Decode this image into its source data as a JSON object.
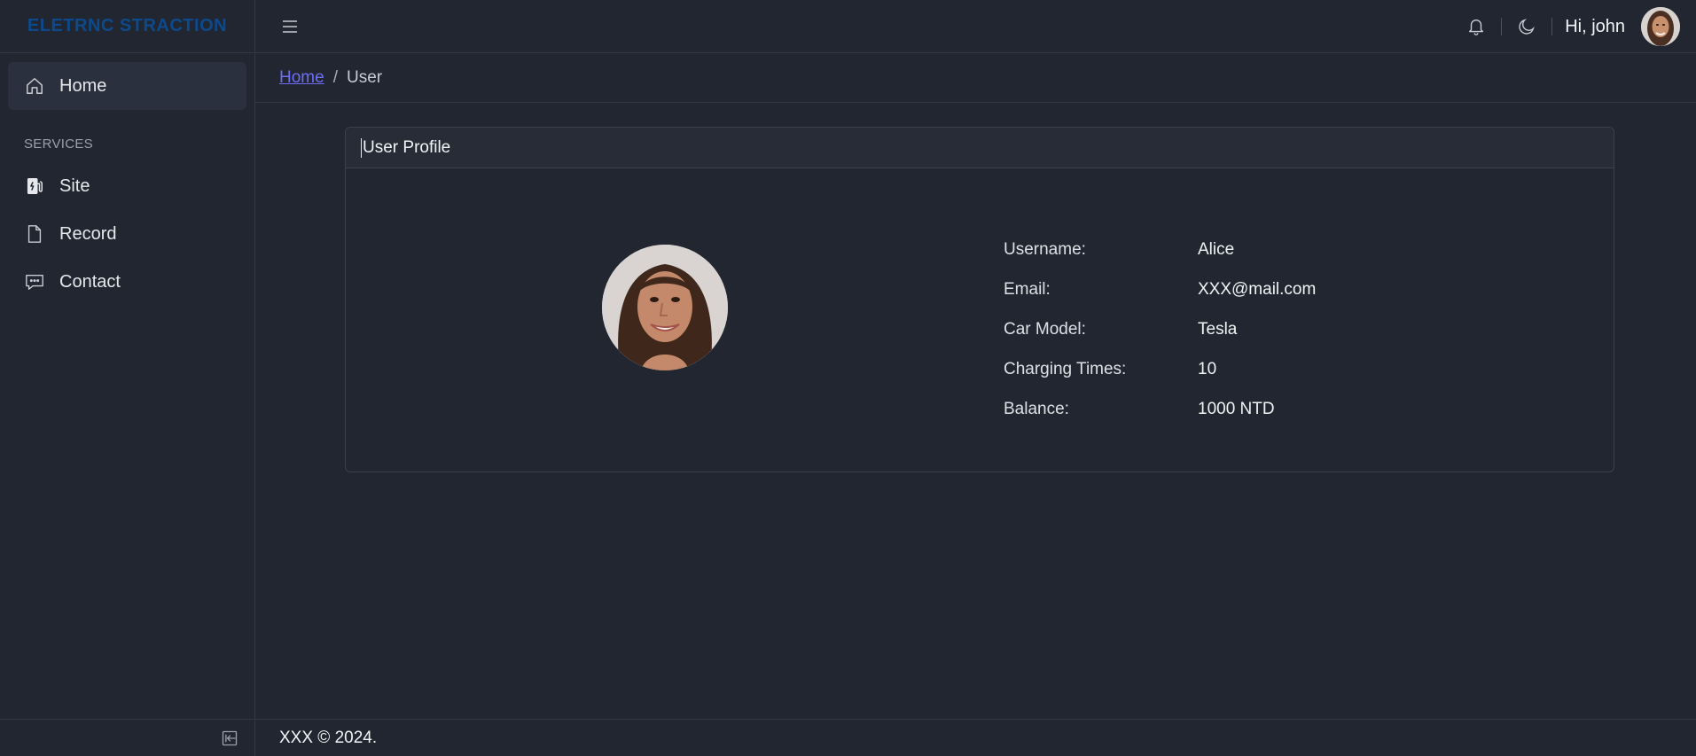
{
  "brand": {
    "name": "ELETRNC STRACTION",
    "color": "#0d4a8c"
  },
  "sidebar": {
    "items_top": [
      {
        "label": "Home",
        "icon": "home-icon",
        "active": true
      }
    ],
    "section_title": "SERVICES",
    "items": [
      {
        "label": "Site",
        "icon": "charging-station-icon"
      },
      {
        "label": "Record",
        "icon": "document-icon"
      },
      {
        "label": "Contact",
        "icon": "chat-icon"
      }
    ],
    "collapse_icon": "collapse-sidebar-icon"
  },
  "header": {
    "menu_icon": "hamburger-icon",
    "notification_icon": "bell-icon",
    "theme_icon": "moon-icon",
    "greeting": "Hi, john"
  },
  "breadcrumb": {
    "home": "Home",
    "separator": "/",
    "current": "User"
  },
  "card": {
    "title": "User Profile",
    "fields": [
      {
        "label": "Username:",
        "value": "Alice"
      },
      {
        "label": "Email:",
        "value": "XXX@mail.com"
      },
      {
        "label": "Car Model:",
        "value": "Tesla"
      },
      {
        "label": "Charging Times:",
        "value": "10"
      },
      {
        "label": "Balance:",
        "value": "1000 NTD"
      }
    ]
  },
  "footer": {
    "text": "XXX © 2024."
  },
  "colors": {
    "link": "#6e6ef5",
    "background": "#212631",
    "surface": "#272c37"
  }
}
